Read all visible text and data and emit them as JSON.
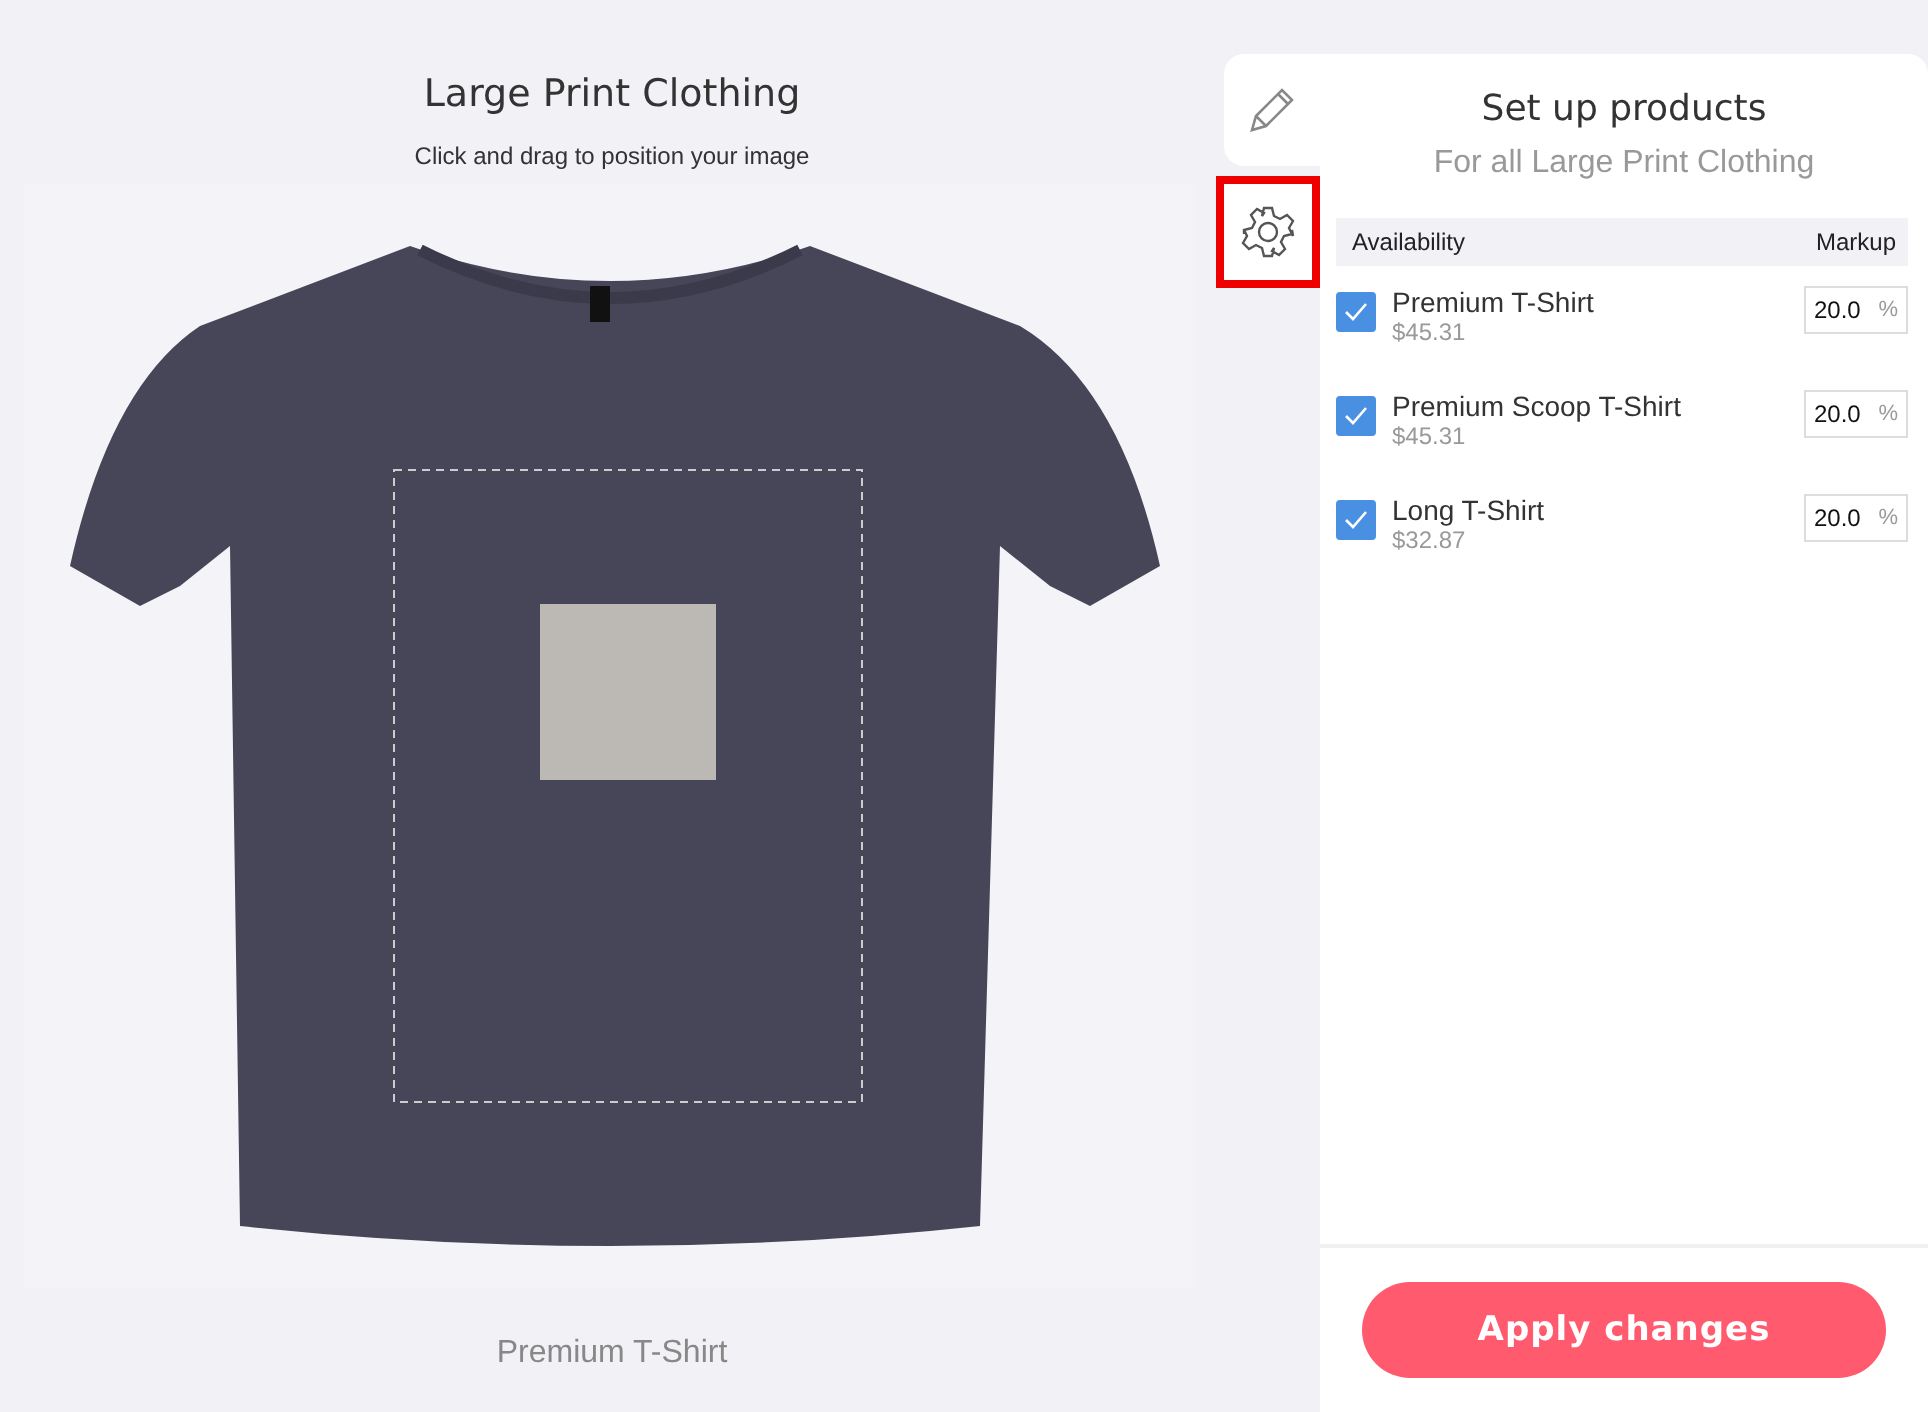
{
  "preview": {
    "title": "Large Print Clothing",
    "hint": "Click and drag to position your image",
    "product_name": "Premium T-Shirt"
  },
  "tools": [
    {
      "kind": "pencil",
      "selected": false
    },
    {
      "kind": "gear",
      "selected": true
    }
  ],
  "panel": {
    "title": "Set up products",
    "subtitle": "For all Large Print Clothing",
    "columns": [
      "Availability",
      "Markup"
    ],
    "products": [
      {
        "name": "Premium T-Shirt",
        "price": "$45.31",
        "checked": true,
        "markup": "20.0",
        "unit": "%"
      },
      {
        "name": "Premium Scoop T-Shirt",
        "price": "$45.31",
        "checked": true,
        "markup": "20.0",
        "unit": "%"
      },
      {
        "name": "Long T-Shirt",
        "price": "$32.87",
        "checked": true,
        "markup": "20.0",
        "unit": "%"
      }
    ],
    "apply_button": "Apply changes"
  }
}
